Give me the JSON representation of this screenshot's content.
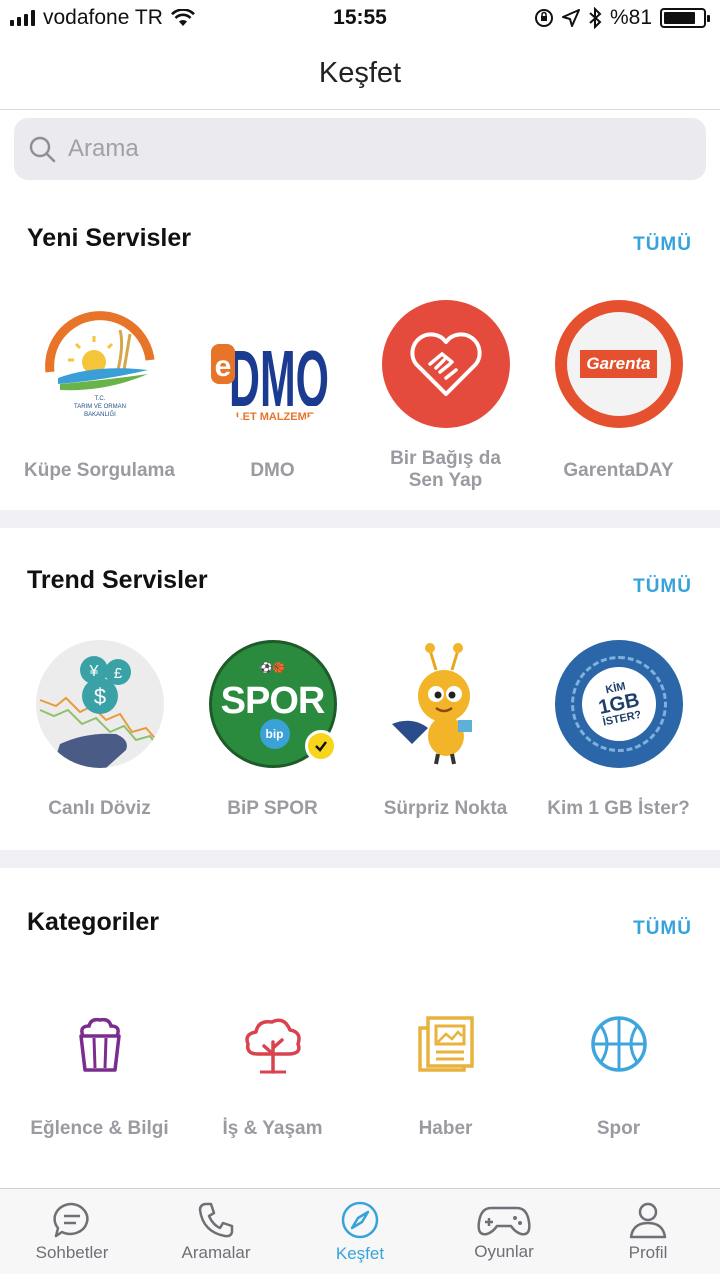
{
  "status_bar": {
    "carrier": "vodafone TR",
    "time": "15:55",
    "battery": "%81",
    "battery_level": 0.81
  },
  "header": {
    "title": "Keşfet"
  },
  "search": {
    "placeholder": "Arama"
  },
  "new_services": {
    "title": "Yeni Servisler",
    "see_all": "TÜMÜ",
    "items": [
      {
        "label": "Küpe Sorgulama",
        "logo_text_line1": "T.C.",
        "logo_text_line2": "TARIM VE ORMAN",
        "logo_text_line3": "BAKANLIĞI"
      },
      {
        "label": "DMO",
        "logo_text": "DMO",
        "logo_prefix": "e",
        "logo_sub": "LET MALZEME"
      },
      {
        "label": "Bir Bağış da Sen Yap"
      },
      {
        "label": "GarentaDAY",
        "logo_text": "Garenta"
      }
    ]
  },
  "trend_services": {
    "title": "Trend Servisler",
    "see_all": "TÜMÜ",
    "items": [
      {
        "label": "Canlı Döviz"
      },
      {
        "label": "BiP SPOR",
        "logo_text": "SPOR",
        "badge_text": "bip"
      },
      {
        "label": "Sürpriz Nokta"
      },
      {
        "label": "Kim 1 GB İster?",
        "logo_line1": "KİM",
        "logo_line2": "1GB",
        "logo_line3": "İSTER?"
      }
    ]
  },
  "categories": {
    "title": "Kategoriler",
    "see_all": "TÜMÜ",
    "items": [
      {
        "label": "Eğlence & Bilgi",
        "icon": "popcorn-icon",
        "color": "#7b2d8f"
      },
      {
        "label": "İş & Yaşam",
        "icon": "tree-icon",
        "color": "#d9434e"
      },
      {
        "label": "Haber",
        "icon": "news-icon",
        "color": "#e8b23c"
      },
      {
        "label": "Spor",
        "icon": "basketball-icon",
        "color": "#3ea6dd"
      }
    ]
  },
  "tabbar": {
    "tabs": [
      {
        "label": "Sohbetler",
        "icon": "chat-icon"
      },
      {
        "label": "Aramalar",
        "icon": "phone-icon"
      },
      {
        "label": "Keşfet",
        "icon": "compass-icon",
        "active": true
      },
      {
        "label": "Oyunlar",
        "icon": "gamepad-icon"
      },
      {
        "label": "Profil",
        "icon": "person-icon"
      }
    ]
  },
  "colors": {
    "accent": "#37a3db",
    "label_gray": "#9a9aa1"
  }
}
